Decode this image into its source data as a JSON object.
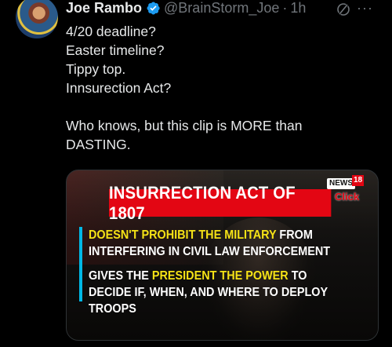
{
  "tweet": {
    "author_name": "Joe Rambo",
    "handle": "@BrainStorm_Joe",
    "separator": "·",
    "time": "1h",
    "more_label": "···",
    "text_lines": [
      "4/20 deadline?",
      "Easter timeline?",
      "Tippy top.",
      "Innsurection Act?",
      "",
      "Who knows, but this clip is MORE than",
      "DASTING."
    ]
  },
  "media": {
    "banner": "INSURRECTION ACT OF 1807",
    "logo_news": "NEWS",
    "logo_number": "18",
    "logo_click": "Click",
    "bullet1_highlight": "DOESN'T PROHIBIT THE MILITARY",
    "bullet1_rest": " FROM INTERFERING IN CIVIL LAW ENFORCEMENT",
    "bullet2_prefix": "GIVES THE ",
    "bullet2_highlight": "PRESIDENT THE POWER",
    "bullet2_rest": " TO DECIDE IF, WHEN, AND WHERE TO DEPLOY TROOPS"
  },
  "colors": {
    "background": "#000000",
    "text": "#e7e9ea",
    "muted": "#71767b",
    "verified": "#1d9bf0",
    "banner_red": "#e30613",
    "highlight_yellow": "#f5e216",
    "bullet_bar": "#00b8e6"
  },
  "icons": [
    "verified-badge-icon",
    "grok-icon",
    "more-icon"
  ]
}
